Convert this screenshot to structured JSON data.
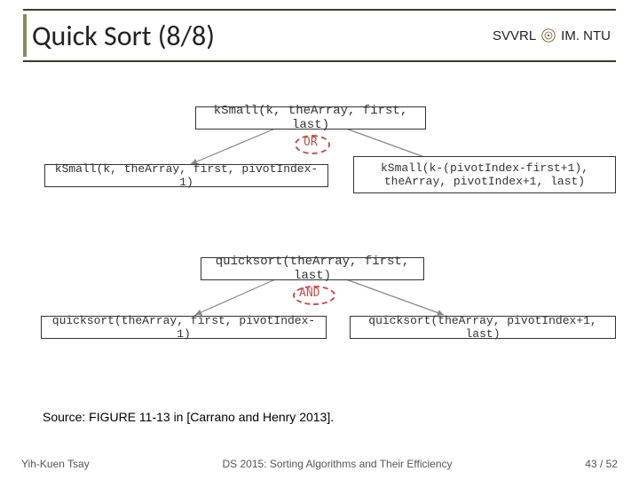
{
  "header": {
    "title": "Quick Sort (8/8)",
    "lab": "SVVRL",
    "at": "@",
    "org": "IM. NTU"
  },
  "diagram": {
    "top_box": "kSmall(k, theArray, first, last)",
    "or_label": "OR",
    "ksmall_left": "kSmall(k, theArray, first, pivotIndex-1)",
    "ksmall_right": "kSmall(k-(pivotIndex-first+1),\ntheArray, pivotIndex+1, last)",
    "qs_top": "quicksort(theArray, first, last)",
    "and_label": "AND",
    "qs_left": "quicksort(theArray, first, pivotIndex-1)",
    "qs_right": "quicksort(theArray, pivotIndex+1, last)"
  },
  "source_line": "Source: FIGURE 11-13 in [Carrano and Henry 2013].",
  "footer": {
    "author": "Yih-Kuen Tsay",
    "course": "DS 2015: Sorting Algorithms and Their Efficiency",
    "page": "43 / 52"
  },
  "chart_data": [
    {
      "type": "diagram",
      "title": "kSmall decomposition",
      "root": "kSmall(k, theArray, first, last)",
      "joiner": "OR",
      "children": [
        "kSmall(k, theArray, first, pivotIndex-1)",
        "kSmall(k-(pivotIndex-first+1), theArray, pivotIndex+1, last)"
      ]
    },
    {
      "type": "diagram",
      "title": "quicksort decomposition",
      "root": "quicksort(theArray, first, last)",
      "joiner": "AND",
      "children": [
        "quicksort(theArray, first, pivotIndex-1)",
        "quicksort(theArray, pivotIndex+1, last)"
      ]
    }
  ]
}
